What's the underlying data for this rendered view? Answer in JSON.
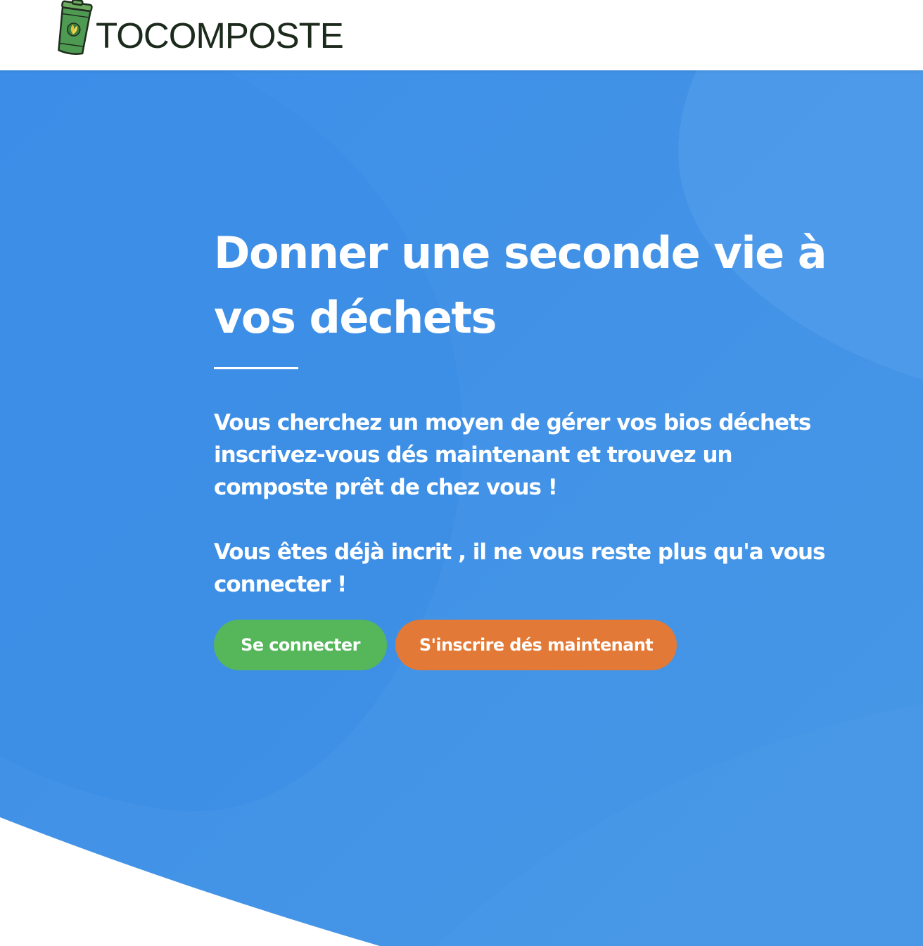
{
  "header": {
    "brand_name": "TOCOMPOSTE",
    "logo_icon": "compost-bin-icon",
    "brand_color": "#4e9a4e"
  },
  "hero": {
    "title": "Donner une seconde vie à vos déchets",
    "paragraph_1": "Vous cherchez un moyen de gérer vos bios déchets inscrivez-vous dés maintenant et trouvez un composte prêt de chez vous !",
    "paragraph_2": "Vous êtes déjà incrit , il ne vous reste plus qu'a vous connecter !",
    "background_color": "#3e92ea",
    "login_button": {
      "label": "Se connecter",
      "color": "#55b65a"
    },
    "signup_button": {
      "label": "S'inscrire dés maintenant",
      "color": "#e27936"
    }
  }
}
